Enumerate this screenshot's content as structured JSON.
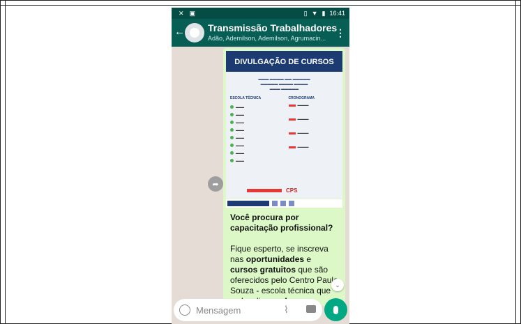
{
  "status_bar": {
    "left_icons": [
      "settings-icon",
      "image-icon"
    ],
    "time": "16:41"
  },
  "chat_header": {
    "title": "Transmissão Trabalhadores",
    "subtitle": "Adão, Ademilson, Ademilson, Agrumacin..."
  },
  "poster": {
    "header": "DIVULGAÇÃO DE CURSOS",
    "left_column_title": "ESCOLA TÉCNICA",
    "right_column_title": "CRONOGRAMA",
    "logo_text": "CPS"
  },
  "message": {
    "heading": "Você procura por capacitação profissional?",
    "intro": "Fique esperto, se inscreva nas",
    "highlight_1": "oportunidades",
    "connector": "e",
    "highlight_2": "cursos gratuitos",
    "body": "que são oferecidos pelo Centro Paula Souza - escola técnica que se locali... em Amparo, cidade vizinha"
  },
  "composer": {
    "placeholder": "Mensagem"
  },
  "colors": {
    "header": "#075e54",
    "status": "#054d44",
    "bubble": "#dcf8c6",
    "accent": "#00a884"
  }
}
